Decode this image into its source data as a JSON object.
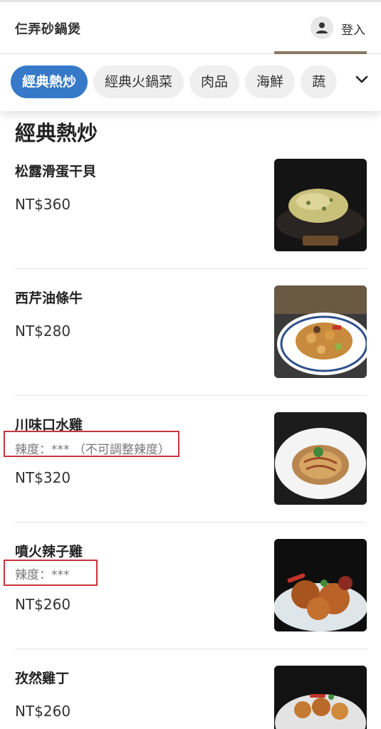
{
  "header": {
    "brand": "仨弄砂鍋煲",
    "login_label": "登入",
    "user_icon": "user-icon"
  },
  "categories": {
    "tabs": [
      {
        "label": "經典熱炒",
        "active": true
      },
      {
        "label": "經典火鍋菜",
        "active": false
      },
      {
        "label": "肉品",
        "active": false
      },
      {
        "label": "海鮮",
        "active": false
      },
      {
        "label": "蔬",
        "active": false
      }
    ],
    "expand_icon": "chevron-down-icon"
  },
  "section": {
    "title": "經典熱炒"
  },
  "menu_items": [
    {
      "name": "松露滑蛋干貝",
      "spicy": "",
      "price": "NT$360"
    },
    {
      "name": "西芹油條牛",
      "spicy": "",
      "price": "NT$280"
    },
    {
      "name": "川味口水雞",
      "spicy": "辣度：*** （不可調整辣度）",
      "price": "NT$320"
    },
    {
      "name": "噴火辣子雞",
      "spicy": "辣度：***",
      "price": "NT$260"
    },
    {
      "name": "孜然雞丁",
      "spicy": "",
      "price": "NT$260"
    }
  ],
  "colors": {
    "accent": "#3579c8",
    "highlight_box": "#c8343b"
  }
}
